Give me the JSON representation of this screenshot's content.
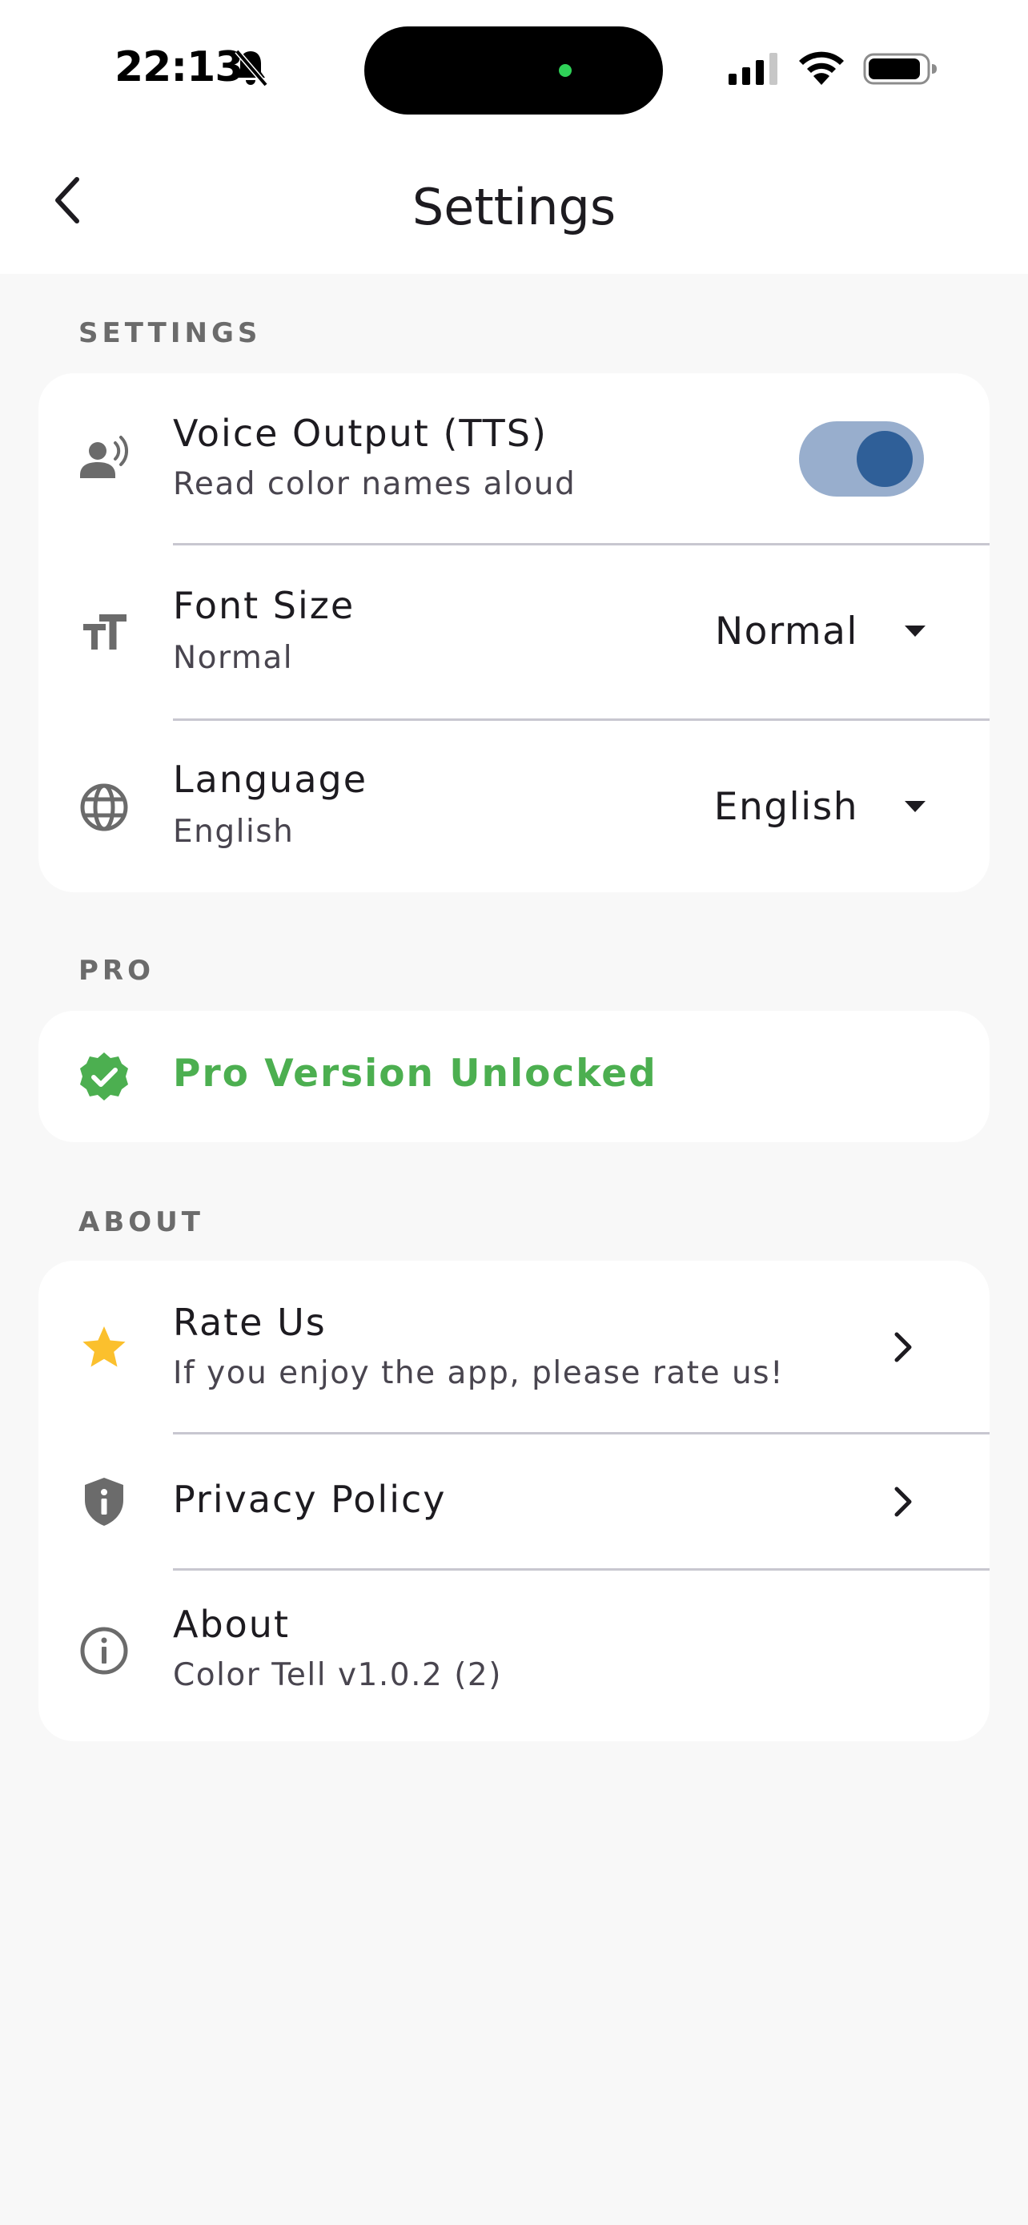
{
  "status_bar": {
    "time": "22:13"
  },
  "app_bar": {
    "title": "Settings"
  },
  "sections": {
    "settings_label": "SETTINGS",
    "pro_label": "PRO",
    "about_label": "ABOUT"
  },
  "settings": {
    "voice": {
      "title": "Voice Output (TTS)",
      "subtitle": "Read color names aloud",
      "enabled": true
    },
    "font_size": {
      "title": "Font Size",
      "subtitle": "Normal",
      "value": "Normal"
    },
    "language": {
      "title": "Language",
      "subtitle": "English",
      "value": "English"
    }
  },
  "pro": {
    "status": "Pro Version Unlocked"
  },
  "about": {
    "rate": {
      "title": "Rate Us",
      "subtitle": "If you enjoy the app, please rate us!"
    },
    "privacy": {
      "title": "Privacy Policy"
    },
    "info": {
      "title": "About",
      "subtitle": "Color Tell v1.0.2 (2)"
    }
  },
  "colors": {
    "accent_green": "#4caf50",
    "star_yellow": "#fbc02d",
    "toggle_track": "#98aecd",
    "toggle_knob": "#2f5f98",
    "background": "#f8f8f8"
  },
  "icons": {
    "back": "arrow-back-icon",
    "voice": "record-voice-icon",
    "font": "text-size-icon",
    "language": "globe-icon",
    "pro": "verified-badge-icon",
    "rate": "star-icon",
    "privacy": "shield-info-icon",
    "about": "info-icon"
  }
}
